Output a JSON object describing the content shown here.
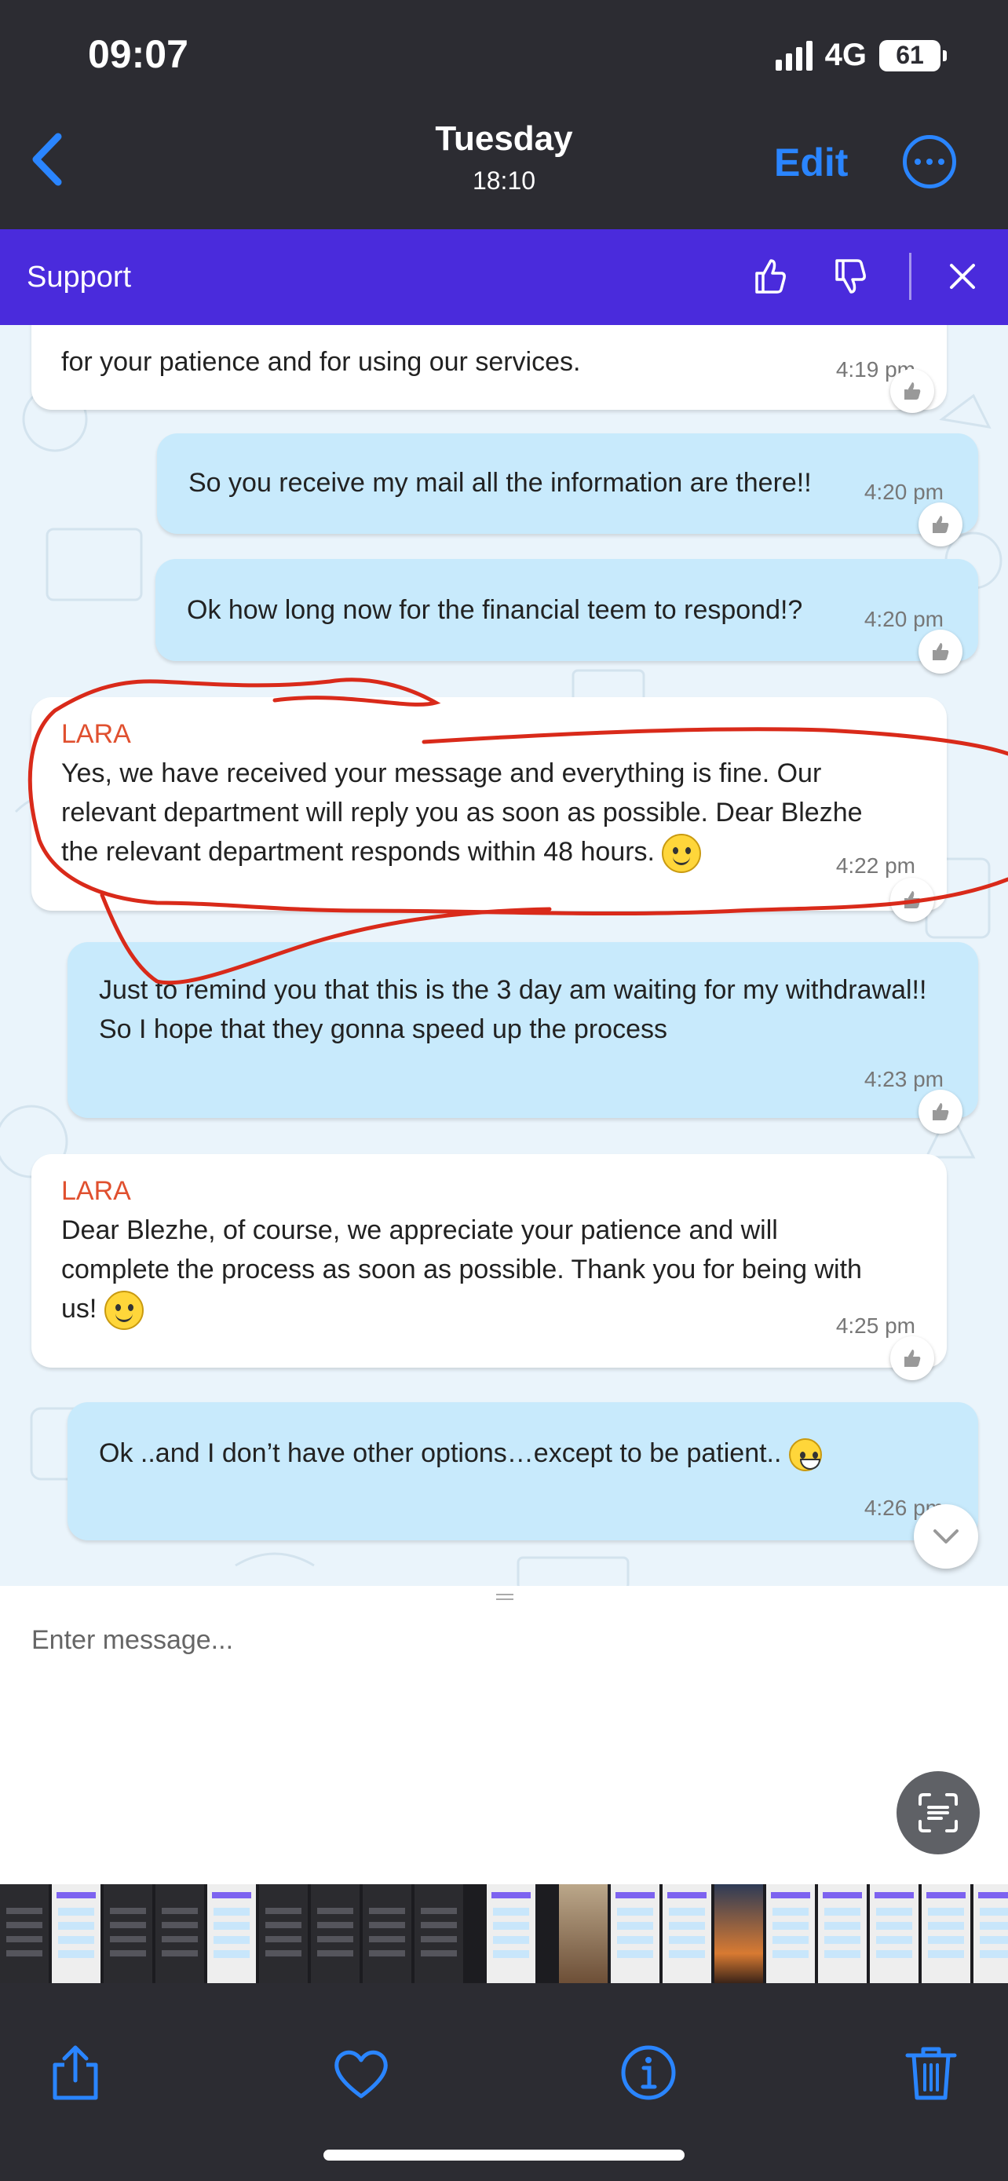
{
  "status_bar": {
    "time": "09:07",
    "network": "4G",
    "battery": "61"
  },
  "photo_nav": {
    "title": "Tuesday",
    "subtitle": "18:10",
    "edit_label": "Edit"
  },
  "chat_header": {
    "title": "Support"
  },
  "messages": [
    {
      "direction": "in",
      "sender": "",
      "text": "for your patience and for using our services.",
      "time": "4:19 pm"
    },
    {
      "direction": "out",
      "sender": "",
      "text": "So you receive my mail all the information are there!!",
      "time": "4:20 pm"
    },
    {
      "direction": "out",
      "sender": "",
      "text": "Ok how long now for the financial teem to respond!?",
      "time": "4:20 pm"
    },
    {
      "direction": "in",
      "sender": "LARA",
      "text": "Yes, we have received your message and everything is fine. Our relevant department will reply you as soon as possible. Dear Blezhe the relevant department responds within 48 hours.",
      "time": "4:22 pm"
    },
    {
      "direction": "out",
      "sender": "",
      "text": "Just to remind you that this is the 3 day am waiting for my withdrawal!! So I hope that they gonna speed up the process",
      "time": "4:23 pm"
    },
    {
      "direction": "in",
      "sender": "LARA",
      "text": "Dear Blezhe, of course, we appreciate your patience and will complete the process as soon as possible. Thank you for being with us!",
      "time": "4:25 pm"
    },
    {
      "direction": "out",
      "sender": "",
      "text": "Ok ..and I don’t have other options…except to be patient..",
      "time": "4:26 pm"
    }
  ],
  "composer": {
    "placeholder": "Enter message..."
  },
  "colors": {
    "header": "#4a2bdc",
    "chat_bg": "#eaf4fb",
    "outgoing_bubble": "#c8eafc",
    "sender": "#e0502f",
    "ios_blue": "#2a85ff",
    "annotation": "#d92a1a"
  },
  "icons": {
    "nav": [
      "chevron-left-icon",
      "more-icon"
    ],
    "header": [
      "thumbs-up-icon",
      "thumbs-down-icon",
      "close-icon"
    ],
    "toolbar": [
      "share-icon",
      "heart-icon",
      "info-icon",
      "trash-icon"
    ]
  }
}
